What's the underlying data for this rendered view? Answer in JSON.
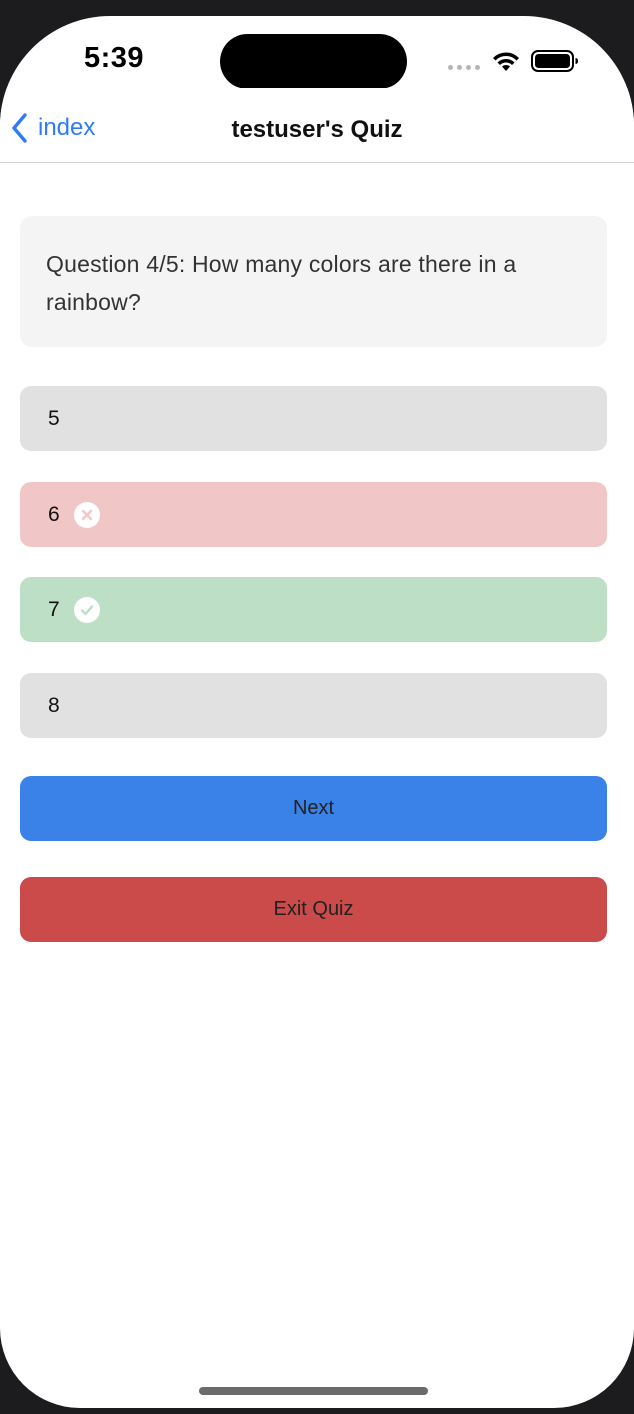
{
  "status_bar": {
    "time": "5:39"
  },
  "nav": {
    "back_label": "index",
    "title": "testuser's Quiz"
  },
  "question": {
    "text": "Question 4/5: How many colors are there in a rainbow?"
  },
  "answers": [
    {
      "label": "5",
      "state": "neutral"
    },
    {
      "label": "6",
      "state": "wrong",
      "icon": "x-circle-icon"
    },
    {
      "label": "7",
      "state": "correct",
      "icon": "check-circle-icon"
    },
    {
      "label": "8",
      "state": "neutral"
    }
  ],
  "buttons": {
    "next_label": "Next",
    "exit_label": "Exit Quiz"
  },
  "colors": {
    "accent_blue": "#3b82e8",
    "exit_red": "#cb4a4a",
    "wrong_bg": "#f1c6c6",
    "correct_bg": "#bcdfc6",
    "neutral_bg": "#e1e1e1",
    "link_blue": "#2f7bf5"
  }
}
